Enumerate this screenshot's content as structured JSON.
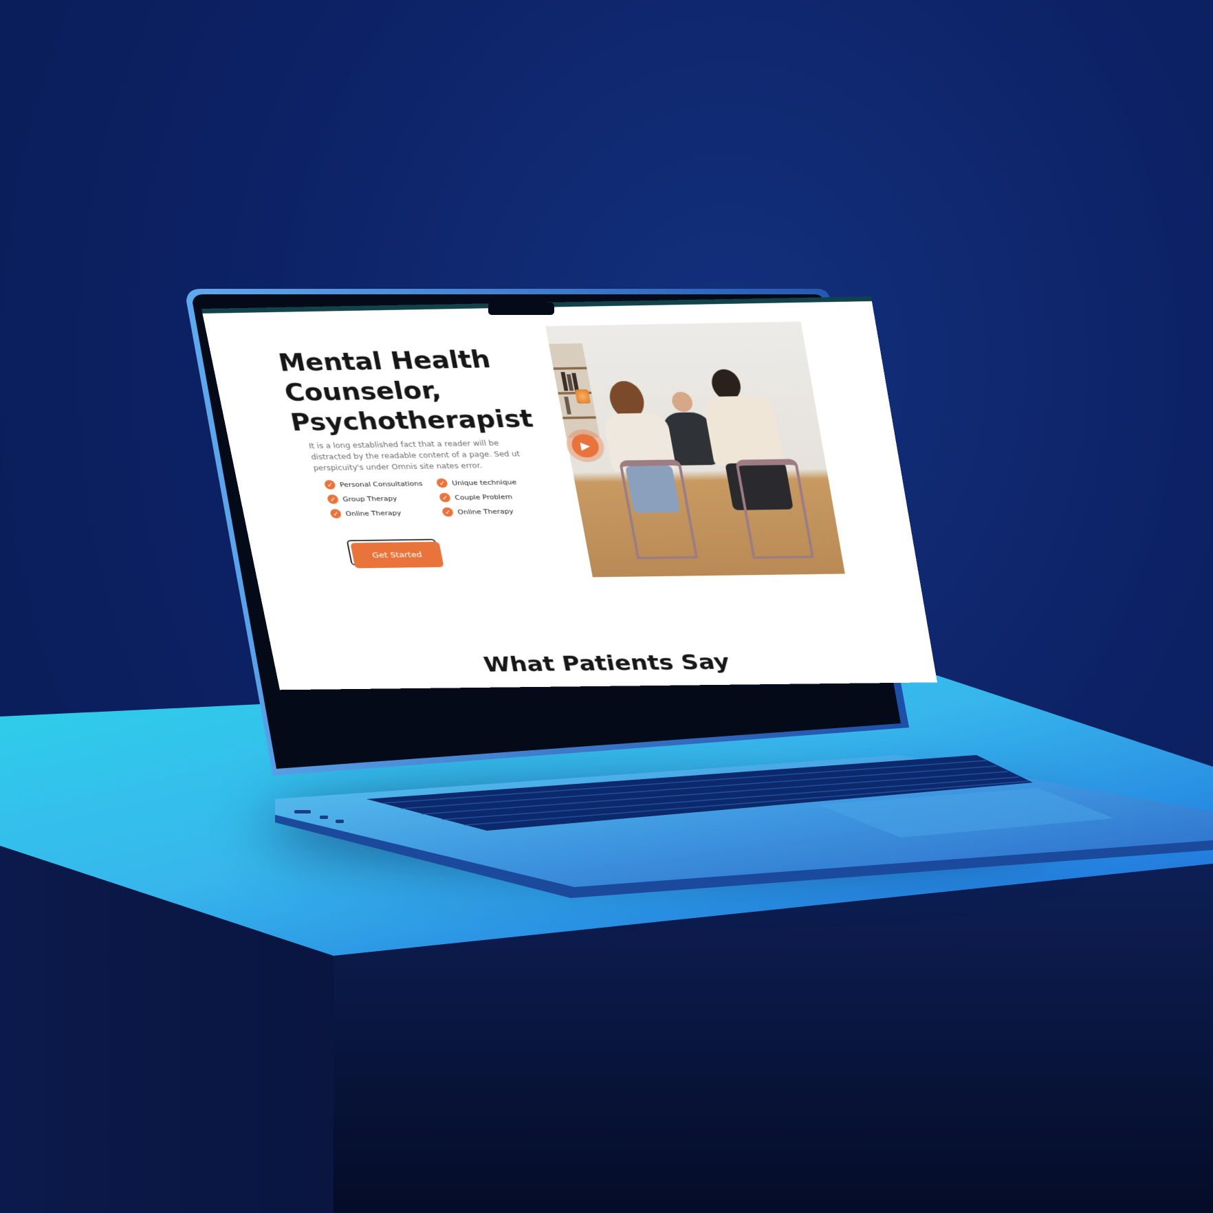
{
  "hero": {
    "title": "Mental Health Counselor, Psychotherapist",
    "description": "It is a long established fact that a reader will be distracted by the readable content of a page. Sed ut perspicuity's under Omnis site nates error.",
    "features": [
      "Personal Consultations",
      "Unique technique",
      "Group Therapy",
      "Couple Problem",
      "Online Therapy",
      "Online Therapy"
    ],
    "cta_label": "Get Started",
    "check_icon": "check-icon",
    "play_icon": "play-icon"
  },
  "testimonials": {
    "title": "What Patients Say"
  },
  "colors": {
    "accent": "#e8743c",
    "heading": "#171717",
    "body_text": "#6d6d6d",
    "top_strip": "#12424a",
    "background": "#0d2266",
    "laptop": "#3b8ad8"
  }
}
